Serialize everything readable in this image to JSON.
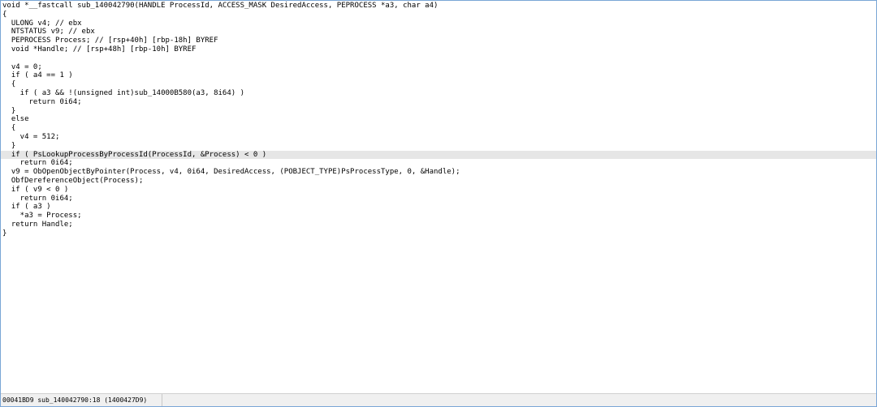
{
  "code_lines": [
    "void *__fastcall sub_140042790(HANDLE ProcessId, ACCESS_MASK DesiredAccess, PEPROCESS *a3, char a4)",
    "{",
    "  ULONG v4; // ebx",
    "  NTSTATUS v9; // ebx",
    "  PEPROCESS Process; // [rsp+40h] [rbp-18h] BYREF",
    "  void *Handle; // [rsp+48h] [rbp-10h] BYREF",
    "",
    "  v4 = 0;",
    "  if ( a4 == 1 )",
    "  {",
    "    if ( a3 && !(unsigned int)sub_14000B580(a3, 8i64) )",
    "      return 0i64;",
    "  }",
    "  else",
    "  {",
    "    v4 = 512;",
    "  }",
    "  if ( PsLookupProcessByProcessId(ProcessId, &Process) < 0 )",
    "    return 0i64;",
    "  v9 = ObOpenObjectByPointer(Process, v4, 0i64, DesiredAccess, (POBJECT_TYPE)PsProcessType, 0, &Handle);",
    "  ObfDereferenceObject(Process);",
    "  if ( v9 < 0 )",
    "    return 0i64;",
    "  if ( a3 )",
    "    *a3 = Process;",
    "  return Handle;",
    "}"
  ],
  "highlighted_line_index": 17,
  "status_bar": {
    "location": "00041BD9 sub_140042790:18 (1400427D9)"
  },
  "colors": {
    "border": "#7aa6d6",
    "highlight_line": "#e6e6e6",
    "paren_match": "#f4c99b"
  }
}
